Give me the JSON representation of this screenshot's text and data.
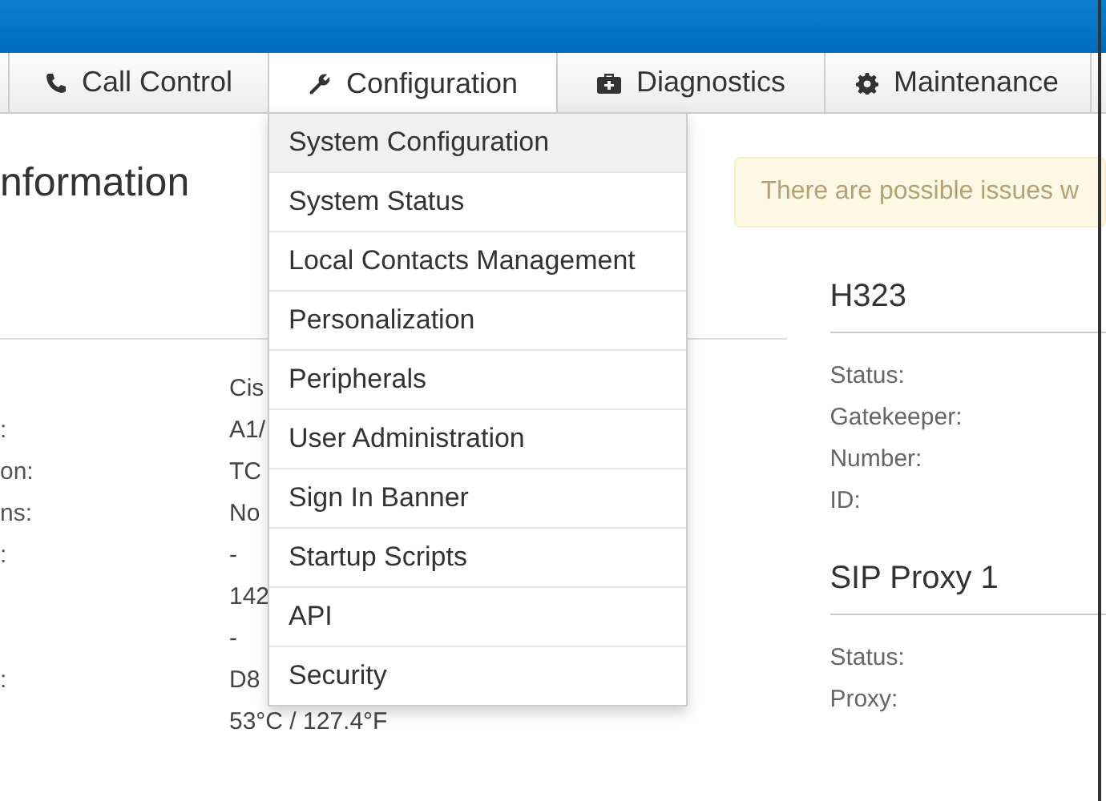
{
  "tabs": [
    {
      "label": "Call Control",
      "selected": false
    },
    {
      "label": "Configuration",
      "selected": true
    },
    {
      "label": "Diagnostics",
      "selected": false
    },
    {
      "label": "Maintenance",
      "selected": false
    }
  ],
  "menu": [
    {
      "label": "System Configuration",
      "selected": true
    },
    {
      "label": "System Status",
      "selected": false
    },
    {
      "label": "Local Contacts Management",
      "selected": false
    },
    {
      "label": "Personalization",
      "selected": false
    },
    {
      "label": "Peripherals",
      "selected": false
    },
    {
      "label": "User Administration",
      "selected": false
    },
    {
      "label": "Sign In Banner",
      "selected": false
    },
    {
      "label": "Startup Scripts",
      "selected": false
    },
    {
      "label": "API",
      "selected": false
    },
    {
      "label": "Security",
      "selected": false
    }
  ],
  "page_title": "nformation",
  "alert": "There are possible issues w",
  "info_rows": [
    {
      "label": "",
      "value": "Cis"
    },
    {
      "label": ":",
      "value": "A1/"
    },
    {
      "label": "on:",
      "value": "TC"
    },
    {
      "label": "ns:",
      "value": "No"
    },
    {
      "label": ":",
      "value": "-"
    },
    {
      "label": "",
      "value": "142"
    },
    {
      "label": "",
      "value": "-"
    },
    {
      "label": ":",
      "value": "D8"
    },
    {
      "label": "",
      "value": "53°C / 127.4°F"
    }
  ],
  "sections": [
    {
      "title": "H323",
      "fields": [
        "Status:",
        "Gatekeeper:",
        "Number:",
        "ID:"
      ]
    },
    {
      "title": "SIP Proxy 1",
      "fields": [
        "Status:",
        "Proxy:"
      ]
    }
  ]
}
